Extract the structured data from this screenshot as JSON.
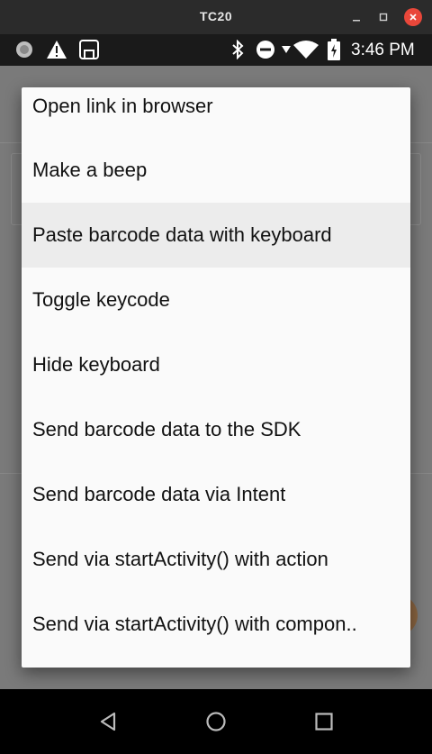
{
  "window": {
    "title": "TC20"
  },
  "statusbar": {
    "time": "3:46 PM"
  },
  "menu": {
    "items": [
      {
        "label": "Open link in browser"
      },
      {
        "label": "Make a beep"
      },
      {
        "label": "Paste barcode data with keyboard"
      },
      {
        "label": "Toggle keycode"
      },
      {
        "label": "Hide keyboard"
      },
      {
        "label": "Send barcode data to the SDK"
      },
      {
        "label": "Send barcode data via Intent"
      },
      {
        "label": "Send via startActivity() with action"
      },
      {
        "label": "Send via startActivity() with compon.."
      }
    ],
    "highlighted_index": 2
  },
  "colors": {
    "close_button": "#e9473a",
    "menu_bg": "#fafafa",
    "highlight": "#ececec"
  }
}
